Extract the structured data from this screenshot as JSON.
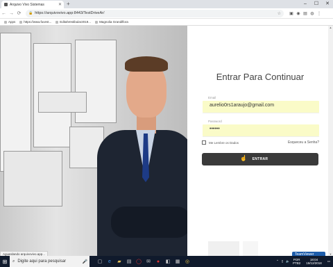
{
  "browser": {
    "tab_title": "Arquivo Vivo Sistemas",
    "url": "https://arquivovivo.app:8443/TestDriveAr/",
    "bookmarks": [
      "Apps",
      "https://www.fuvest...",
      "EditalVestibular2019...",
      "Magnolia Grandiflora"
    ]
  },
  "login": {
    "title": "Entrar Para Continuar",
    "email_label": "Email",
    "email_value": "aurelio0rs1araujo@gmail.com",
    "password_label": "Password",
    "password_value": "••••••",
    "remember_label": "Me Lembre os Dados",
    "forgot_label": "Esqueceu a Senha?",
    "submit_label": "ENTRAR"
  },
  "status_tip": "Aguardando arquivovivo.app...",
  "teamviewer_label": "TeamViewer",
  "taskbar": {
    "search_placeholder": "Digite aqui para pesquisar",
    "language": "POR",
    "layout": "PTB2",
    "time": "18:04",
    "date": "19/12/2018"
  }
}
